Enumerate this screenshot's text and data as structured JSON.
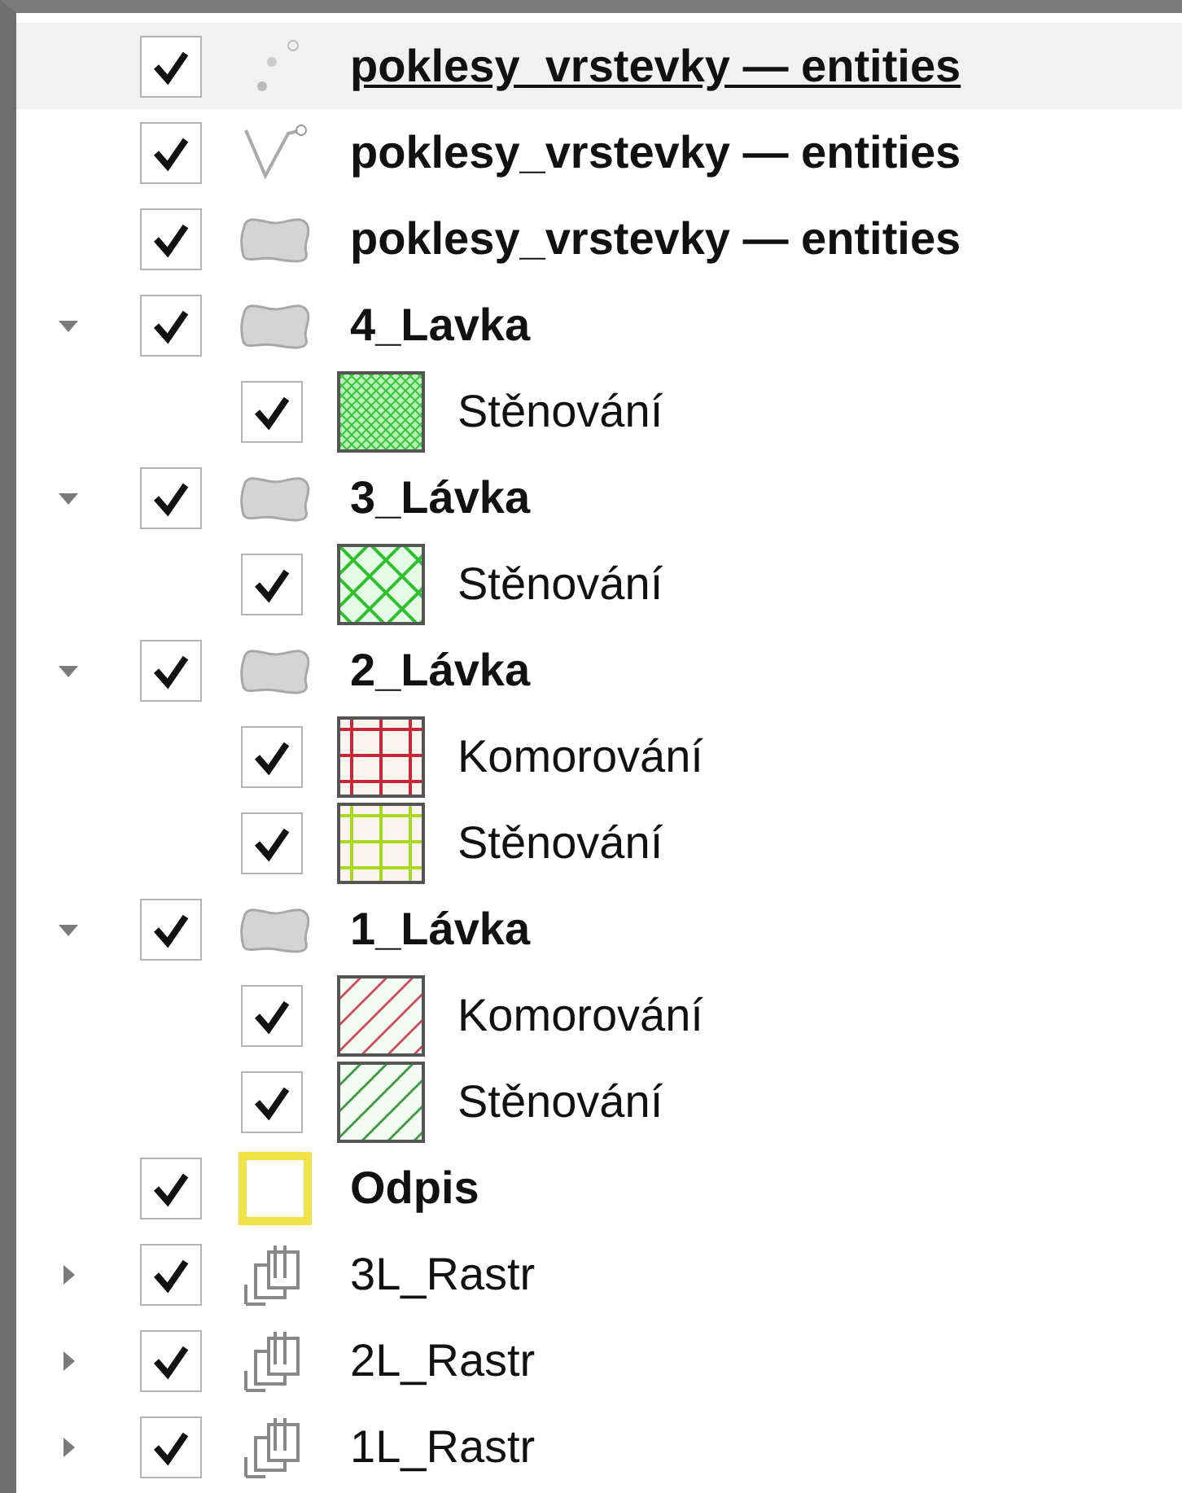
{
  "layers": [
    {
      "kind": "points",
      "name": "poklesy_vrstevky — entities",
      "checked": true,
      "selected": true
    },
    {
      "kind": "lines",
      "name": "poklesy_vrstevky — entities",
      "checked": true,
      "selected": false
    },
    {
      "kind": "polygons",
      "name": "poklesy_vrstevky — entities",
      "checked": true,
      "selected": false
    },
    {
      "kind": "polygons",
      "name": "4_Lavka",
      "checked": true,
      "selected": false,
      "expanded": true,
      "legend": [
        {
          "name": "Stěnování",
          "checked": true,
          "kind": "crosshatch",
          "color": "#3cc43c"
        }
      ]
    },
    {
      "kind": "polygons",
      "name": "3_Lávka",
      "checked": true,
      "selected": false,
      "expanded": true,
      "legend": [
        {
          "name": "Stěnování",
          "checked": true,
          "kind": "lattice",
          "color": "#2fbf2f"
        }
      ]
    },
    {
      "kind": "polygons",
      "name": "2_Lávka",
      "checked": true,
      "selected": false,
      "expanded": true,
      "legend": [
        {
          "name": "Komorování",
          "checked": true,
          "kind": "grid",
          "color": "#c8283c"
        },
        {
          "name": "Stěnování",
          "checked": true,
          "kind": "grid",
          "color": "#a8d820"
        }
      ]
    },
    {
      "kind": "polygons",
      "name": "1_Lávka",
      "checked": true,
      "selected": false,
      "expanded": true,
      "legend": [
        {
          "name": "Komorování",
          "checked": true,
          "kind": "hatch",
          "color": "#d05060"
        },
        {
          "name": "Stěnování",
          "checked": true,
          "kind": "hatch",
          "color": "#40a040"
        }
      ]
    },
    {
      "kind": "outline",
      "name": "Odpis",
      "checked": true,
      "selected": false,
      "color": "#f2e24a"
    },
    {
      "kind": "raster",
      "name": "3L_Rastr",
      "checked": true,
      "selected": false,
      "expanded": false
    },
    {
      "kind": "raster",
      "name": "2L_Rastr",
      "checked": true,
      "selected": false,
      "expanded": false
    },
    {
      "kind": "raster",
      "name": "1L_Rastr",
      "checked": true,
      "selected": false,
      "expanded": false
    }
  ]
}
